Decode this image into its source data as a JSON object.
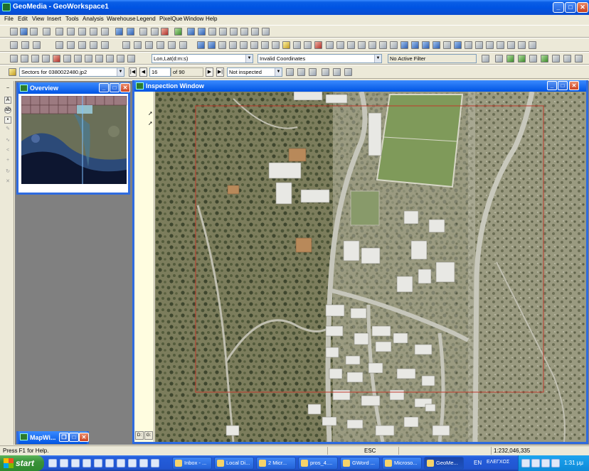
{
  "window": {
    "title": "GeoMedia - GeoWorkspace1",
    "minimize": "_",
    "maximize": "□",
    "close": "✕"
  },
  "menu": [
    "File",
    "Edit",
    "View",
    "Insert",
    "Tools",
    "Analysis",
    "Warehouse",
    "Legend",
    "PixelQue",
    "Window",
    "Help"
  ],
  "toolbar2": {
    "coord_system": "Lon,Lat(d:m:s)",
    "coordinates": "Invalid Coordinates",
    "filter": "No Active Filter"
  },
  "toolbar3": {
    "sector": "Sectors for 0380022480.jp2",
    "current": "16",
    "of_total": "of 90",
    "status": "Not inspected"
  },
  "overview": {
    "title": "Overview"
  },
  "inspection": {
    "title": "Inspection Window",
    "bottom_tabs": [
      "D:",
      "G:"
    ]
  },
  "mapwindow": {
    "title": "MapWi..."
  },
  "status": {
    "help": "Press F1 for Help.",
    "key": "ESC",
    "scale": "1:232,046,335"
  },
  "taskbar": {
    "start": "start",
    "tasks": [
      "Inbox - ...",
      "Local Di...",
      "2 Micr...",
      "pros_4....",
      "GWord ...",
      "Microso...",
      "GeoMe..."
    ],
    "language": "EN",
    "tray_text": "ΕΛΕΓΧΟΣ",
    "clock": "1:31 μμ"
  },
  "colors": {
    "title_blue": "#0054e3",
    "sector_red": "#c0392b",
    "map_land": "#8a8f6a"
  }
}
